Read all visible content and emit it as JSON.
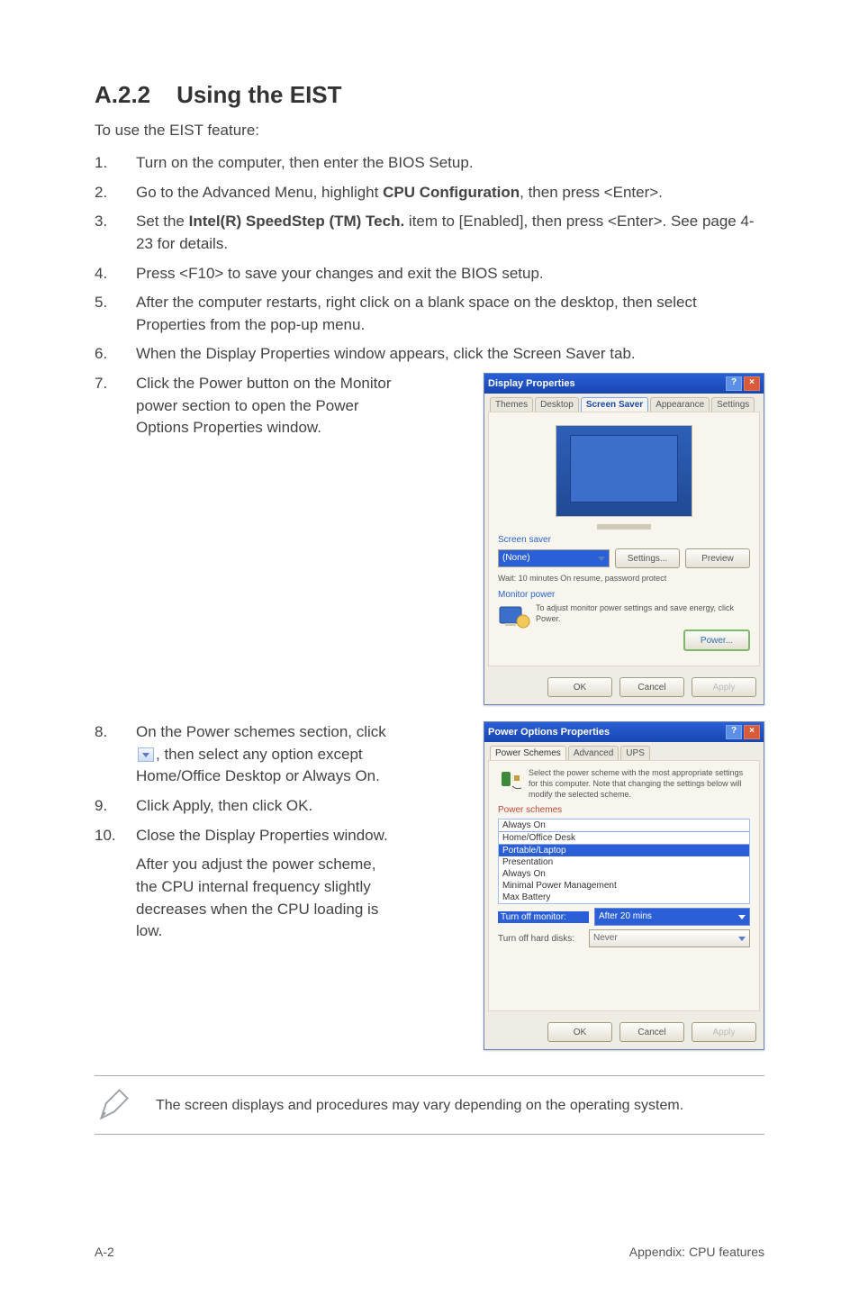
{
  "section": {
    "number": "A.2.2",
    "title": "Using the EIST"
  },
  "intro": "To use the EIST feature:",
  "steps": [
    {
      "n": "1.",
      "html": "Turn on the computer, then enter the BIOS Setup."
    },
    {
      "n": "2.",
      "html": "Go to the Advanced Menu, highlight <b>CPU Configuration</b>, then press <Enter>."
    },
    {
      "n": "3.",
      "html": "Set the <b>Intel(R) SpeedStep (TM) Tech.</b> item to [Enabled], then press <Enter>. See page 4-23 for details."
    },
    {
      "n": "4.",
      "html": "Press <F10> to save your changes and exit the BIOS setup."
    },
    {
      "n": "5.",
      "html": "After the computer restarts, right click on a blank space on the desktop, then select Properties from the pop-up menu."
    },
    {
      "n": "6.",
      "html": "When the Display Properties window appears, click the Screen Saver tab."
    }
  ],
  "step7": {
    "n": "7.",
    "text": "Click the Power button on the Monitor power section to open the Power Options Properties window."
  },
  "step8": {
    "n": "8.",
    "pre": "On the Power schemes section, click ",
    "post": ", then select any option except Home/Office Desktop or Always On."
  },
  "step9": {
    "n": "9.",
    "text": "Click Apply, then click OK."
  },
  "step10": {
    "n": "10.",
    "text": "Close the Display Properties window.",
    "sub": "After you adjust the power scheme, the CPU internal frequency slightly decreases when the CPU loading is low."
  },
  "note": "The screen displays and procedures may vary depending on the operating system.",
  "dialog1": {
    "title": "Display Properties",
    "tabs": [
      "Themes",
      "Desktop",
      "Screen Saver",
      "Appearance",
      "Settings"
    ],
    "active_tab": "Screen Saver",
    "group1_label": "Screen saver",
    "select_value": "(None)",
    "settings_btn": "Settings...",
    "preview_btn": "Preview",
    "wait_row": "Wait: 10 minutes   On resume, password protect",
    "group2_label": "Monitor power",
    "monitor_text": "To adjust monitor power settings and save energy, click Power.",
    "power_btn": "Power...",
    "ok": "OK",
    "cancel": "Cancel",
    "apply": "Apply"
  },
  "dialog2": {
    "title": "Power Options Properties",
    "tabs": [
      "Power Schemes",
      "Advanced",
      "UPS"
    ],
    "active_tab": "Power Schemes",
    "desc": "Select the power scheme with the most appropriate settings for this computer. Note that changing the settings below will modify the selected scheme.",
    "group_label": "Power schemes",
    "options": [
      "Always On",
      "Home/Office Desk",
      "Portable/Laptop",
      "Presentation",
      "Always On",
      "Minimal Power Management",
      "Max Battery"
    ],
    "selected": "Portable/Laptop",
    "row1_label": "Turn off monitor:",
    "row1_value": "After 20 mins",
    "row2_label": "Turn off hard disks:",
    "row2_value": "Never",
    "ok": "OK",
    "cancel": "Cancel",
    "apply": "Apply"
  },
  "footer": {
    "left": "A-2",
    "right": "Appendix: CPU features"
  }
}
